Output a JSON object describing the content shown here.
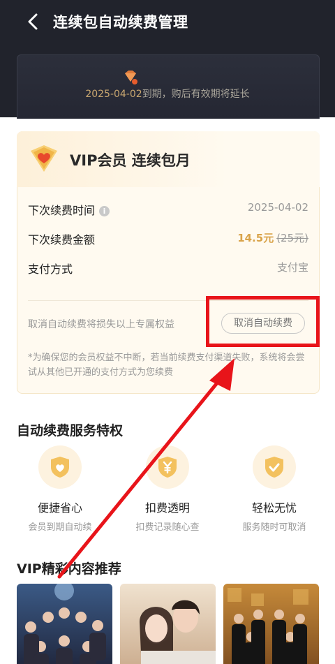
{
  "nav": {
    "title": "连续包自动续费管理",
    "back_icon": "chevron-left-icon"
  },
  "status": {
    "date": "2025-04-02",
    "suffix": "到期，购后有效期将延长"
  },
  "vip": {
    "title": "VIP会员  连续包月",
    "rows": [
      {
        "label": "下次续费时间",
        "value": "2025-04-02"
      },
      {
        "label": "下次续费金额",
        "price": "14.5元",
        "original_price": "(25元)"
      },
      {
        "label": "支付方式",
        "value": "支付宝"
      }
    ],
    "cancel_hint": "取消自动续费将损失以上专属权益",
    "cancel_button": "取消自动续费",
    "note": "*为确保您的会员权益不中断，若当前续费支付渠道失败，系统将会尝试从其他已开通的支付方式为您续费"
  },
  "privileges": {
    "title": "自动续费服务特权",
    "items": [
      {
        "title": "便捷省心",
        "subtitle": "会员到期自动续",
        "icon": "heart-shield-icon"
      },
      {
        "title": "扣费透明",
        "subtitle": "扣费记录随心查",
        "icon": "yen-shield-icon"
      },
      {
        "title": "轻松无忧",
        "subtitle": "服务随时可取消",
        "icon": "check-shield-icon"
      }
    ]
  },
  "recommend": {
    "title": "VIP精彩内容推荐"
  },
  "colors": {
    "header_bg": "#21232c",
    "gold": "#d9a34a",
    "highlight_red": "#e8141a"
  }
}
